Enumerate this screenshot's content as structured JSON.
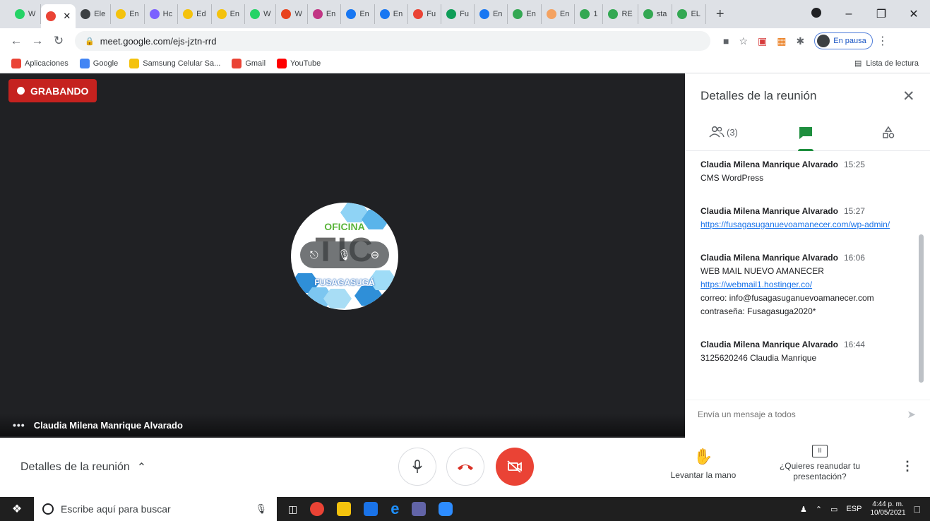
{
  "browser": {
    "tabs": [
      {
        "label": "W",
        "color": "#25d366"
      },
      {
        "label": "",
        "color": "#ea4335",
        "active": true
      },
      {
        "label": "Ele",
        "color": "#3c4043"
      },
      {
        "label": "En",
        "color": "#f4c20d"
      },
      {
        "label": "Hc",
        "color": "#7b61ff"
      },
      {
        "label": "Ed",
        "color": "#f4c20d"
      },
      {
        "label": "En",
        "color": "#f4c20d"
      },
      {
        "label": "W",
        "color": "#25d366"
      },
      {
        "label": "W",
        "color": "#e8431e"
      },
      {
        "label": "En",
        "color": "#c13584"
      },
      {
        "label": "En",
        "color": "#1877f2"
      },
      {
        "label": "En",
        "color": "#1877f2"
      },
      {
        "label": "Fu",
        "color": "#ea4335"
      },
      {
        "label": "Fu",
        "color": "#0f9d58"
      },
      {
        "label": "En",
        "color": "#1877f2"
      },
      {
        "label": "En",
        "color": "#34a853"
      },
      {
        "label": "En",
        "color": "#f4a261"
      },
      {
        "label": "1",
        "color": "#34a853"
      },
      {
        "label": "RE",
        "color": "#34a853"
      },
      {
        "label": "sta",
        "color": "#34a853"
      },
      {
        "label": "EL",
        "color": "#34a853"
      }
    ],
    "new_tab": "+",
    "url": "meet.google.com/ejs-jztn-rrd",
    "profile_status": "En pausa",
    "bookmarks": [
      {
        "label": "Aplicaciones",
        "color": "#ea4335"
      },
      {
        "label": "Google",
        "color": "#4285f4"
      },
      {
        "label": "Samsung Celular Sa...",
        "color": "#f4c20d"
      },
      {
        "label": "Gmail",
        "color": "#ea4335"
      },
      {
        "label": "YouTube",
        "color": "#ff0000"
      }
    ],
    "reading_list": "Lista de lectura"
  },
  "meet": {
    "recording_label": "GRABANDO",
    "participant_name": "Claudia Milena Manrique Alvarado",
    "avatar_logo": {
      "top": "OFICINA",
      "mid": "TIC",
      "bottom": "FUSAGASUGÁ"
    },
    "panel": {
      "title": "Detalles de la reunión",
      "people_count": "(3)",
      "messages": [
        {
          "sender": "Claudia Milena Manrique Alvarado",
          "time": "15:25",
          "lines": [
            "CMS WordPress"
          ],
          "link": ""
        },
        {
          "sender": "Claudia Milena Manrique Alvarado",
          "time": "15:27",
          "lines": [],
          "link": "https://fusagasuganuevoamanecer.com/wp-admin/"
        },
        {
          "sender": "Claudia Milena Manrique Alvarado",
          "time": "16:06",
          "lines": [
            "WEB MAIL NUEVO AMANECER"
          ],
          "link": "https://webmail1.hostinger.co/",
          "after": [
            "correo: info@fusagasuganuevoamanecer.com",
            "contraseña: Fusagasuga2020*"
          ]
        },
        {
          "sender": "Claudia Milena Manrique Alvarado",
          "time": "16:44",
          "lines": [
            "3125620246 Claudia Manrique"
          ],
          "link": ""
        }
      ],
      "compose_placeholder": "Envía un mensaje a todos"
    },
    "bottom_bar": {
      "meeting_details": "Detalles de la reunión",
      "raise_hand": "Levantar la mano",
      "present_line1": "¿Quieres reanudar tu",
      "present_line2": "presentación?"
    }
  },
  "taskbar": {
    "search_placeholder": "Escribe aquí para buscar",
    "language": "ESP",
    "time": "4:44 p. m.",
    "date": "10/05/2021"
  }
}
